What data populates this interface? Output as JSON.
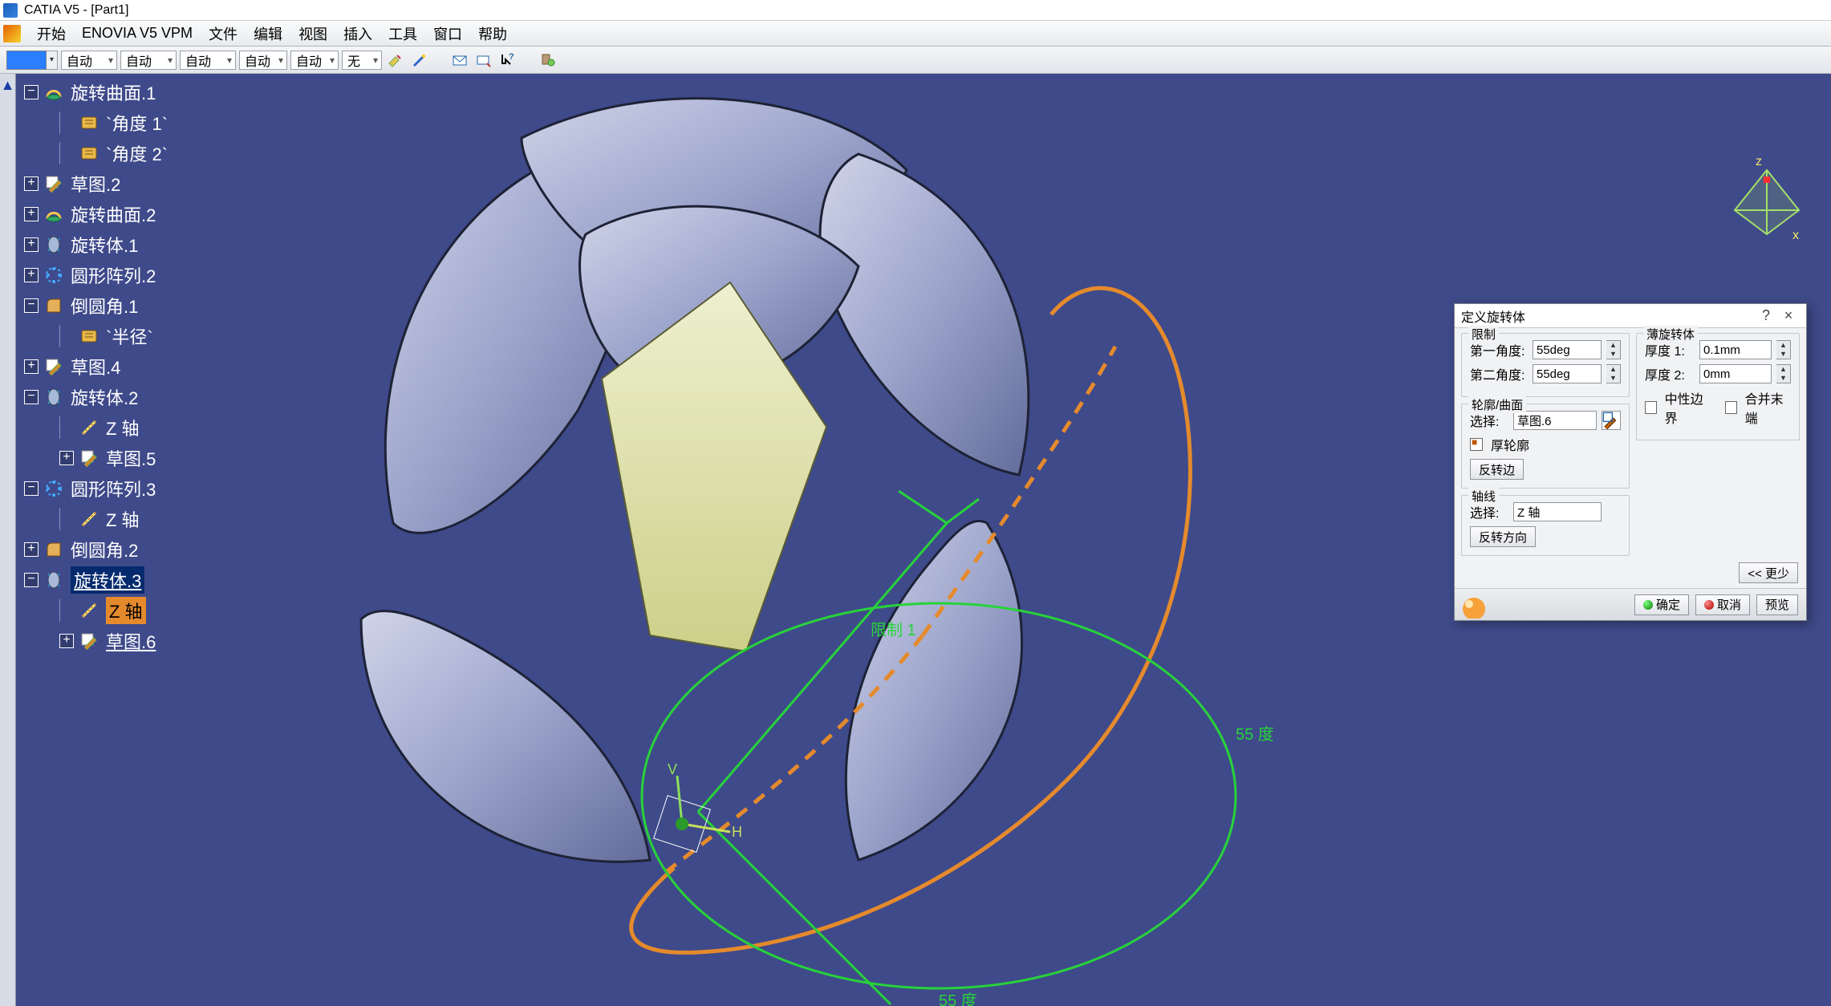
{
  "title": "CATIA V5 - [Part1]",
  "menu": [
    "开始",
    "ENOVIA V5 VPM",
    "文件",
    "编辑",
    "视图",
    "插入",
    "工具",
    "窗口",
    "帮助"
  ],
  "toolbar": {
    "auto1": "自动",
    "auto2": "自动",
    "auto3": "自动",
    "auto4": "自动",
    "auto5": "自动",
    "none": "无"
  },
  "tree": [
    {
      "type": "node",
      "exp": "−",
      "ico": "revolve",
      "label": "旋转曲面.1",
      "indent": 1
    },
    {
      "type": "leaf",
      "ico": "param",
      "label": "`角度 1`",
      "indent": 2
    },
    {
      "type": "leaf",
      "ico": "param",
      "label": "`角度 2`",
      "indent": 2
    },
    {
      "type": "node",
      "exp": "+",
      "ico": "sketch",
      "label": "草图.2",
      "indent": 1
    },
    {
      "type": "node",
      "exp": "+",
      "ico": "revolve",
      "label": "旋转曲面.2",
      "indent": 1
    },
    {
      "type": "node",
      "exp": "+",
      "ico": "shaft",
      "label": "旋转体.1",
      "indent": 1
    },
    {
      "type": "node",
      "exp": "+",
      "ico": "pattern",
      "label": "圆形阵列.2",
      "indent": 1
    },
    {
      "type": "node",
      "exp": "−",
      "ico": "fillet",
      "label": "倒圆角.1",
      "indent": 1
    },
    {
      "type": "leaf",
      "ico": "param",
      "label": "`半径`",
      "indent": 2
    },
    {
      "type": "node",
      "exp": "+",
      "ico": "sketch",
      "label": "草图.4",
      "indent": 1
    },
    {
      "type": "node",
      "exp": "−",
      "ico": "shaft",
      "label": "旋转体.2",
      "indent": 1
    },
    {
      "type": "leaf",
      "ico": "axis",
      "label": "Z 轴",
      "indent": 2
    },
    {
      "type": "node",
      "exp": "+",
      "ico": "sketch",
      "label": "草图.5",
      "indent": 2
    },
    {
      "type": "node",
      "exp": "−",
      "ico": "pattern",
      "label": "圆形阵列.3",
      "indent": 1
    },
    {
      "type": "leaf",
      "ico": "axis",
      "label": "Z 轴",
      "indent": 2
    },
    {
      "type": "node",
      "exp": "+",
      "ico": "fillet",
      "label": "倒圆角.2",
      "indent": 1
    },
    {
      "type": "node",
      "exp": "−",
      "ico": "shaft",
      "label": "旋转体.3",
      "indent": 1,
      "under": true,
      "cur": true
    },
    {
      "type": "leaf",
      "ico": "axis",
      "label": "Z 轴",
      "indent": 2,
      "sel": true
    },
    {
      "type": "node",
      "exp": "+",
      "ico": "sketch",
      "label": "草图.6",
      "indent": 2,
      "under": true
    }
  ],
  "dialog": {
    "title": "定义旋转体",
    "help": "?",
    "close": "×",
    "g_limit": "限制",
    "angle1_l": "第一角度:",
    "angle1_v": "55deg",
    "angle2_l": "第二角度:",
    "angle2_v": "55deg",
    "g_profile": "轮廓/曲面",
    "sel_l": "选择:",
    "sel_v": "草图.6",
    "thick_chk": "厚轮廓",
    "reverse_side": "反转边",
    "g_axis": "轴线",
    "axis_sel_l": "选择:",
    "axis_sel_v": "Z 轴",
    "reverse_dir": "反转方向",
    "g_thin": "薄旋转体",
    "t1_l": "厚度 1:",
    "t1_v": "0.1mm",
    "t2_l": "厚度 2:",
    "t2_v": "0mm",
    "neutral": "中性边界",
    "merge": "合并末端",
    "less": "<< 更少",
    "ok": "确定",
    "cancel": "取消",
    "preview": "预览"
  },
  "annotations": {
    "lim1": "限制 1",
    "deg55a": "55 度",
    "deg55b": "55 度"
  },
  "axes": {
    "h": "H",
    "v": "V",
    "z": "z",
    "x": "x"
  }
}
